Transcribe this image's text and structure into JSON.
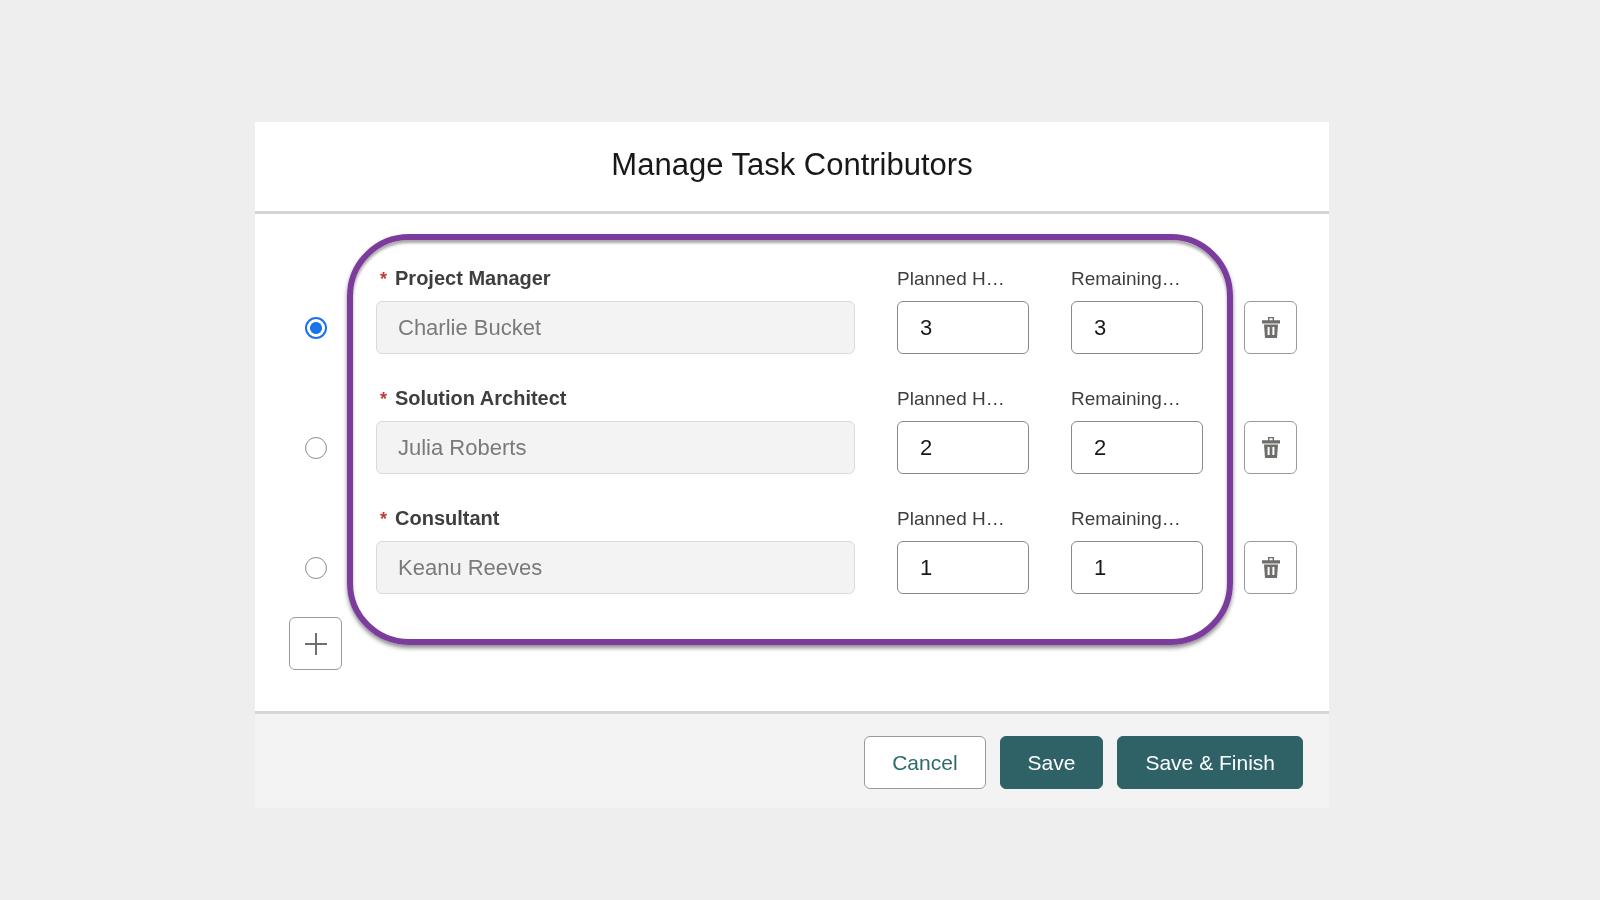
{
  "dialog": {
    "title": "Manage Task Contributors",
    "contributors": [
      {
        "selected": true,
        "required_mark": "*",
        "role": "Project Manager",
        "name": {
          "value": "Charlie Bucket",
          "disabled": true
        },
        "planned": {
          "label": "Planned H…",
          "value": "3"
        },
        "remaining": {
          "label": "Remaining…",
          "value": "3"
        }
      },
      {
        "selected": false,
        "required_mark": "*",
        "role": "Solution Architect",
        "name": {
          "value": "Julia Roberts",
          "disabled": true
        },
        "planned": {
          "label": "Planned H…",
          "value": "2"
        },
        "remaining": {
          "label": "Remaining…",
          "value": "2"
        }
      },
      {
        "selected": false,
        "required_mark": "*",
        "role": "Consultant",
        "name": {
          "value": "Keanu Reeves",
          "disabled": true
        },
        "planned": {
          "label": "Planned H…",
          "value": "1"
        },
        "remaining": {
          "label": "Remaining…",
          "value": "1"
        }
      }
    ],
    "footer_buttons": [
      {
        "label": "Cancel",
        "kind": "neutral"
      },
      {
        "label": "Save",
        "kind": "brand"
      },
      {
        "label": "Save & Finish",
        "kind": "brand"
      }
    ]
  }
}
